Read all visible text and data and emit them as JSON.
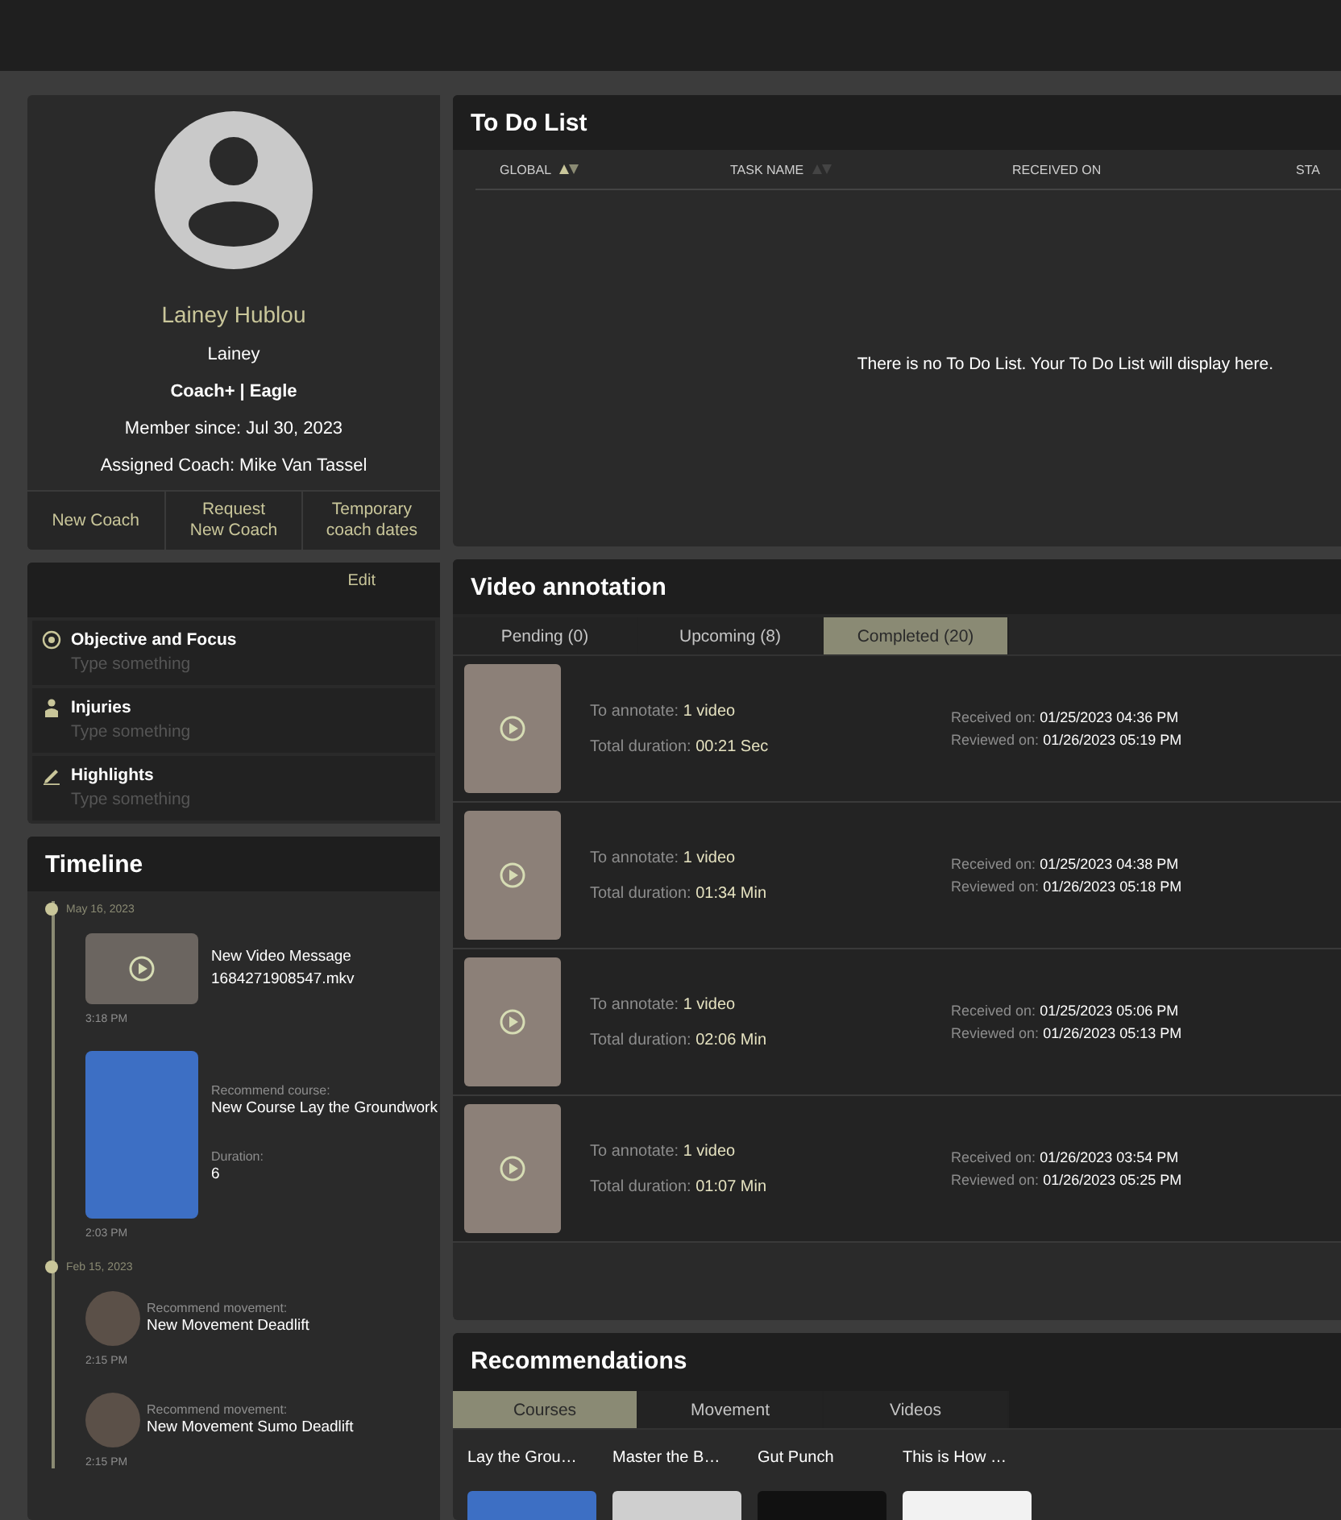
{
  "profile": {
    "name": "Lainey Hublou",
    "nickname": "Lainey",
    "plan": "Coach+ | Eagle",
    "member_since": "Member since: Jul 30, 2023",
    "assigned_coach": "Assigned Coach: Mike Van Tassel",
    "buttons": [
      "New Coach",
      "Request\nNew Coach",
      "Temporary\ncoach dates"
    ]
  },
  "notes": {
    "edit_label": "Edit",
    "items": [
      {
        "title": "Objective and Focus",
        "placeholder": "Type something"
      },
      {
        "title": "Injuries",
        "placeholder": "Type something"
      },
      {
        "title": "Highlights",
        "placeholder": "Type something"
      }
    ]
  },
  "timeline": {
    "title": "Timeline",
    "groups": [
      {
        "date": "May 16, 2023",
        "entries": [
          {
            "kind": "video_message",
            "title": "New Video Message",
            "subtitle": "1684271908547.mkv",
            "time": "3:18 PM"
          },
          {
            "kind": "course",
            "label": "Recommend course:",
            "title": "New Course Lay the Groundwork",
            "duration_label": "Duration:",
            "duration": "6",
            "time": "2:03 PM"
          }
        ]
      },
      {
        "date": "Feb 15, 2023",
        "entries": [
          {
            "kind": "movement",
            "label": "Recommend movement:",
            "title": "New Movement Deadlift",
            "time": "2:15 PM"
          },
          {
            "kind": "movement",
            "label": "Recommend movement:",
            "title": "New Movement Sumo Deadlift",
            "time": "2:15 PM"
          }
        ]
      }
    ]
  },
  "todo": {
    "title": "To Do List",
    "columns": [
      {
        "label": "GLOBAL",
        "sort_active": true
      },
      {
        "label": "TASK NAME",
        "sort_active": false
      },
      {
        "label": "RECEIVED ON"
      },
      {
        "label": "STA"
      }
    ],
    "empty_message": "There is no To Do List. Your To Do List will display here."
  },
  "video_annotation": {
    "title": "Video annotation",
    "tabs": [
      {
        "label": "Pending (0)",
        "selected": false
      },
      {
        "label": "Upcoming (8)",
        "selected": false
      },
      {
        "label": "Completed (20)",
        "selected": true
      }
    ],
    "items": [
      {
        "annotate_label": "To annotate:",
        "annotate_value": "1 video",
        "duration_label": "Total duration:",
        "duration_value": "00:21 Sec",
        "received_label": "Received on:",
        "received_value": "01/25/2023 04:36 PM",
        "reviewed_label": "Reviewed on:",
        "reviewed_value": "01/26/2023 05:19 PM"
      },
      {
        "annotate_label": "To annotate:",
        "annotate_value": "1 video",
        "duration_label": "Total duration:",
        "duration_value": "01:34 Min",
        "received_label": "Received on:",
        "received_value": "01/25/2023 04:38 PM",
        "reviewed_label": "Reviewed on:",
        "reviewed_value": "01/26/2023 05:18 PM"
      },
      {
        "annotate_label": "To annotate:",
        "annotate_value": "1 video",
        "duration_label": "Total duration:",
        "duration_value": "02:06 Min",
        "received_label": "Received on:",
        "received_value": "01/25/2023 05:06 PM",
        "reviewed_label": "Reviewed on:",
        "reviewed_value": "01/26/2023 05:13 PM"
      },
      {
        "annotate_label": "To annotate:",
        "annotate_value": "1 video",
        "duration_label": "Total duration:",
        "duration_value": "01:07 Min",
        "received_label": "Received on:",
        "received_value": "01/26/2023 03:54 PM",
        "reviewed_label": "Reviewed on:",
        "reviewed_value": "01/26/2023 05:25 PM"
      }
    ]
  },
  "recommendations": {
    "title": "Recommendations",
    "tabs": [
      {
        "label": "Courses",
        "selected": true
      },
      {
        "label": "Movement",
        "selected": false
      },
      {
        "label": "Videos",
        "selected": false
      }
    ],
    "cards": [
      {
        "title": "Lay the Grou…"
      },
      {
        "title": "Master the B…"
      },
      {
        "title": "Gut Punch"
      },
      {
        "title": "This is How …"
      }
    ]
  }
}
